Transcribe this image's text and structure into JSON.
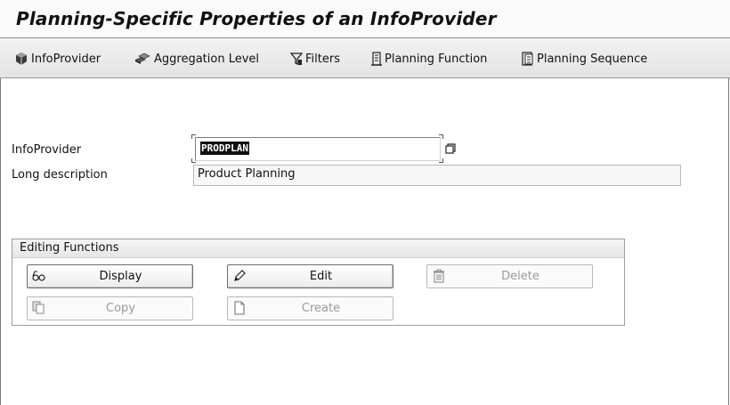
{
  "window": {
    "title": "Planning-Specific Properties of an InfoProvider"
  },
  "toolbar": {
    "items": [
      {
        "label": "InfoProvider",
        "icon": "cube-icon"
      },
      {
        "label": "Aggregation Level",
        "icon": "aggregation-icon"
      },
      {
        "label": "Filters",
        "icon": "filter-icon"
      },
      {
        "label": "Planning Function",
        "icon": "planning-function-icon"
      },
      {
        "label": "Planning Sequence",
        "icon": "planning-sequence-icon"
      }
    ]
  },
  "form": {
    "infoprovider_label": "InfoProvider",
    "infoprovider_value": "PRODPLAN",
    "long_description_label": "Long description",
    "long_description_value": "Product Planning"
  },
  "editing": {
    "title": "Editing Functions",
    "buttons": [
      {
        "label": "Display",
        "icon": "display-glasses-icon",
        "enabled": true
      },
      {
        "label": "Edit",
        "icon": "pencil-icon",
        "enabled": true
      },
      {
        "label": "Delete",
        "icon": "trash-icon",
        "enabled": false
      },
      {
        "label": "Copy",
        "icon": "copy-icon",
        "enabled": false
      },
      {
        "label": "Create",
        "icon": "new-document-icon",
        "enabled": false
      }
    ]
  }
}
